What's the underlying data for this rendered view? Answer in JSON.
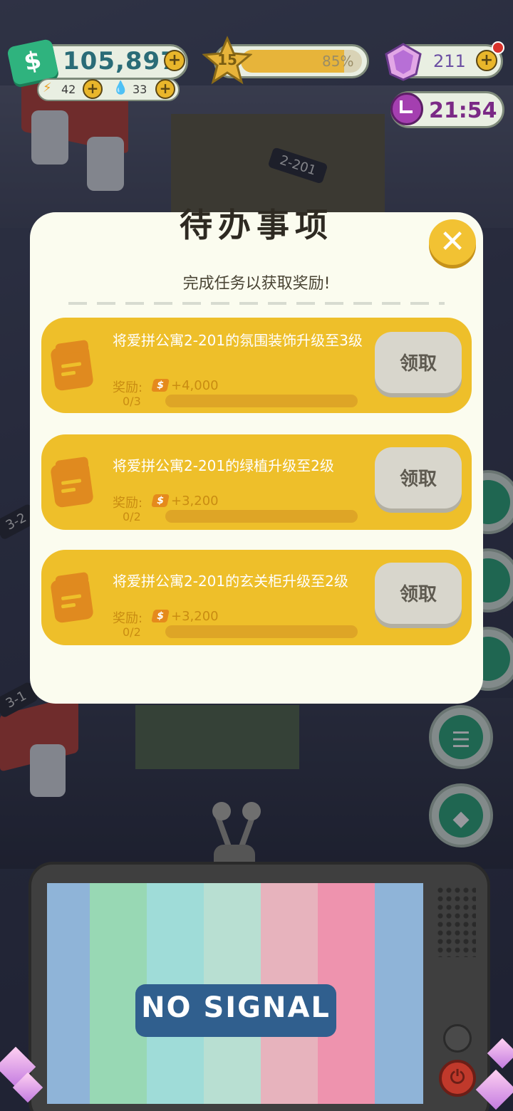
{
  "hud": {
    "money": "105,897",
    "energy": "42",
    "water": "33",
    "level": "15",
    "level_progress_pct": "85%",
    "level_progress_value": 0.85,
    "gems": "211",
    "timer": "21:54"
  },
  "scene": {
    "room_labels": [
      "2-201",
      "3-2",
      "3-1"
    ]
  },
  "modal": {
    "title": "待办事项",
    "subtitle": "完成任务以获取奖励!",
    "reward_label": "奖励:",
    "tasks": [
      {
        "desc": "将爱拼公寓2-201的氛围装饰升级至3级",
        "reward": "+4,000",
        "progress": "0/3",
        "claim": "领取"
      },
      {
        "desc": "将爱拼公寓2-201的绿植升级至2级",
        "reward": "+3,200",
        "progress": "0/2",
        "claim": "领取"
      },
      {
        "desc": "将爱拼公寓2-201的玄关柜升级至2级",
        "reward": "+3,200",
        "progress": "0/2",
        "claim": "领取"
      }
    ]
  },
  "tv": {
    "signal_text": "NO SIGNAL"
  },
  "colors": {
    "task_card": "#eebf2a",
    "modal_bg": "#fbfcef",
    "close_button": "#f2c233",
    "money_icon": "#2fb37e"
  },
  "icons": {
    "money": "dollar-icon",
    "energy": "bolt-icon",
    "water": "drop-icon",
    "level": "star-icon",
    "gems": "gem-icon",
    "timer": "clock-icon",
    "close": "close-icon",
    "task": "notepad-icon",
    "reward_currency": "cash-icon",
    "tv_power": "power-icon"
  }
}
